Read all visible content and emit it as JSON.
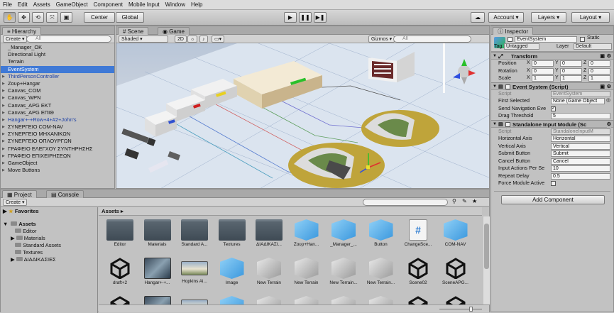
{
  "menu": [
    "File",
    "Edit",
    "Assets",
    "GameObject",
    "Component",
    "Mobile Input",
    "Window",
    "Help"
  ],
  "toolbar": {
    "center": "Center",
    "global": "Global",
    "account": "Account",
    "layers": "Layers",
    "layout": "Layout"
  },
  "hierarchy": {
    "tab": "Hierarchy",
    "create": "Create",
    "search": "All",
    "items": [
      {
        "label": "_Manager_OK",
        "fold": false,
        "sel": false,
        "blue": false
      },
      {
        "label": "Directional Light",
        "fold": false,
        "sel": false,
        "blue": false
      },
      {
        "label": "Terrain",
        "fold": false,
        "sel": false,
        "blue": false
      },
      {
        "label": "EventSystem",
        "fold": false,
        "sel": true,
        "blue": false
      },
      {
        "label": "ThirdPersonController",
        "fold": true,
        "sel": false,
        "blue": true
      },
      {
        "label": "Ζουρ+Hangar",
        "fold": true,
        "sel": false,
        "blue": false
      },
      {
        "label": "Canvas_COM",
        "fold": true,
        "sel": false,
        "blue": false
      },
      {
        "label": "Canvas_WPN",
        "fold": true,
        "sel": false,
        "blue": false
      },
      {
        "label": "Canvas_APG ΕΚΤ",
        "fold": true,
        "sel": false,
        "blue": false
      },
      {
        "label": "Canvas_APG ΕΠΙΘ",
        "fold": true,
        "sel": false,
        "blue": false
      },
      {
        "label": "Hangar+-+Row+4+#2+John's",
        "fold": true,
        "sel": false,
        "blue": true
      },
      {
        "label": "ΣΥΝΕΡΓΕΙΟ COM-NAV",
        "fold": true,
        "sel": false,
        "blue": false
      },
      {
        "label": "ΣΥΝΕΡΓΕΙΟ ΜΗΧΑΝΙΚΩΝ",
        "fold": true,
        "sel": false,
        "blue": false
      },
      {
        "label": "ΣΥΝΕΡΓΕΙΟ ΟΠΛΟΥΡΓΩΝ",
        "fold": true,
        "sel": false,
        "blue": false
      },
      {
        "label": "ΓΡΑΦΕΙΟ ΕΛΕΓΧΟΥ ΣΥΝΤΗΡΗΣΗΣ",
        "fold": true,
        "sel": false,
        "blue": false
      },
      {
        "label": "ΓΡΑΦΕΙΟ ΕΠΙΧΕΙΡΗΣΕΩΝ",
        "fold": true,
        "sel": false,
        "blue": false
      },
      {
        "label": "GameObject",
        "fold": true,
        "sel": false,
        "blue": false
      },
      {
        "label": "Move Buttons",
        "fold": true,
        "sel": false,
        "blue": false
      }
    ]
  },
  "scene": {
    "tab_scene": "Scene",
    "tab_game": "Game",
    "shaded": "Shaded",
    "mode2d": "2D",
    "gizmos": "Gizmos",
    "search": "All"
  },
  "inspector": {
    "tab": "Inspector",
    "name": "EventSystem",
    "static": "Static",
    "tag_label": "Tag",
    "tag": "Untagged",
    "layer_label": "Layer",
    "layer": "Default",
    "transform": {
      "title": "Transform",
      "rows": [
        {
          "label": "Position",
          "x": "0",
          "y": "0",
          "z": "0"
        },
        {
          "label": "Rotation",
          "x": "0",
          "y": "0",
          "z": "0"
        },
        {
          "label": "Scale",
          "x": "1",
          "y": "1",
          "z": "1"
        }
      ]
    },
    "event_system": {
      "title": "Event System (Script)",
      "script_label": "Script",
      "script": "EventSystem",
      "first_selected_label": "First Selected",
      "first_selected": "None (Game Object",
      "send_nav_label": "Send Navigation Eve",
      "drag_label": "Drag Threshold",
      "drag": "5"
    },
    "standalone": {
      "title": "Standalone Input Module (Sc",
      "script_label": "Script",
      "script": "StandaloneInputM",
      "rows": [
        {
          "label": "Horizontal Axis",
          "value": "Horizontal"
        },
        {
          "label": "Vertical Axis",
          "value": "Vertical"
        },
        {
          "label": "Submit Button",
          "value": "Submit"
        },
        {
          "label": "Cancel Button",
          "value": "Cancel"
        },
        {
          "label": "Input Actions Per Se",
          "value": "10"
        },
        {
          "label": "Repeat Delay",
          "value": "0.5"
        }
      ],
      "force_label": "Force Module Active"
    },
    "add_component": "Add Component"
  },
  "project": {
    "tab_project": "Project",
    "tab_console": "Console",
    "create": "Create",
    "favorites": "Favorites",
    "breadcrumb": "Assets",
    "tree": [
      "Assets",
      "Editor",
      "Materials",
      "Standard Assets",
      "Textures",
      "ΔΙΑΔΙΚΑΣΙΕΣ"
    ],
    "row1": [
      {
        "name": "Editor",
        "type": "folder"
      },
      {
        "name": "Materials",
        "type": "folder"
      },
      {
        "name": "Standard A...",
        "type": "folder"
      },
      {
        "name": "Textures",
        "type": "folder"
      },
      {
        "name": "ΔΙΑΔΙΚΑΣΙ...",
        "type": "folder"
      },
      {
        "name": "Ζουρ+Han...",
        "type": "cube"
      },
      {
        "name": "_Manager_...",
        "type": "cube"
      },
      {
        "name": "Button",
        "type": "cube"
      },
      {
        "name": "ChangeSce...",
        "type": "script"
      },
      {
        "name": "COM-NAV",
        "type": "cube"
      }
    ],
    "row2": [
      {
        "name": "draft+2",
        "type": "unity"
      },
      {
        "name": "Hangar+-+...",
        "type": "image"
      },
      {
        "name": "Hopkins Ai...",
        "type": "image2"
      },
      {
        "name": "Image",
        "type": "cube"
      },
      {
        "name": "New Terrain",
        "type": "gcube"
      },
      {
        "name": "New Terrain",
        "type": "gcube"
      },
      {
        "name": "New Terrain...",
        "type": "gcube"
      },
      {
        "name": "New Terrain...",
        "type": "gcube"
      },
      {
        "name": "Scene02",
        "type": "unity"
      },
      {
        "name": "SceneAPG...",
        "type": "unity"
      }
    ]
  }
}
